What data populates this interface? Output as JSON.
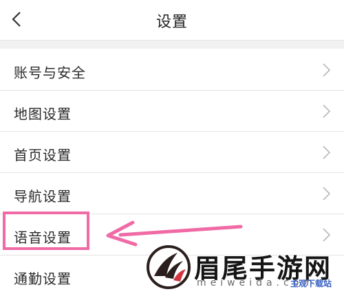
{
  "header": {
    "back_icon": "chevron-left-icon",
    "title": "设置"
  },
  "settings_items": [
    {
      "label": "账号与安全",
      "icon": "chevron-right-icon"
    },
    {
      "label": "地图设置",
      "icon": "chevron-right-icon"
    },
    {
      "label": "首页设置",
      "icon": "chevron-right-icon"
    },
    {
      "label": "导航设置",
      "icon": "chevron-right-icon"
    },
    {
      "label": "语音设置",
      "icon": "chevron-right-icon"
    },
    {
      "label": "通勤设置",
      "icon": "chevron-right-icon"
    }
  ],
  "annotation": {
    "highlight_color": "#f06aa5",
    "arrow_color": "#f06aa5"
  },
  "watermark": {
    "title": "眉尾手游网",
    "subtitle": "meiweida.com",
    "overlay": "主观下载站"
  },
  "colors": {
    "text": "#2a2a2a",
    "divider": "#e3e3e3",
    "section_gap": "#f1f1f1",
    "chevron": "#b8b8b8"
  }
}
